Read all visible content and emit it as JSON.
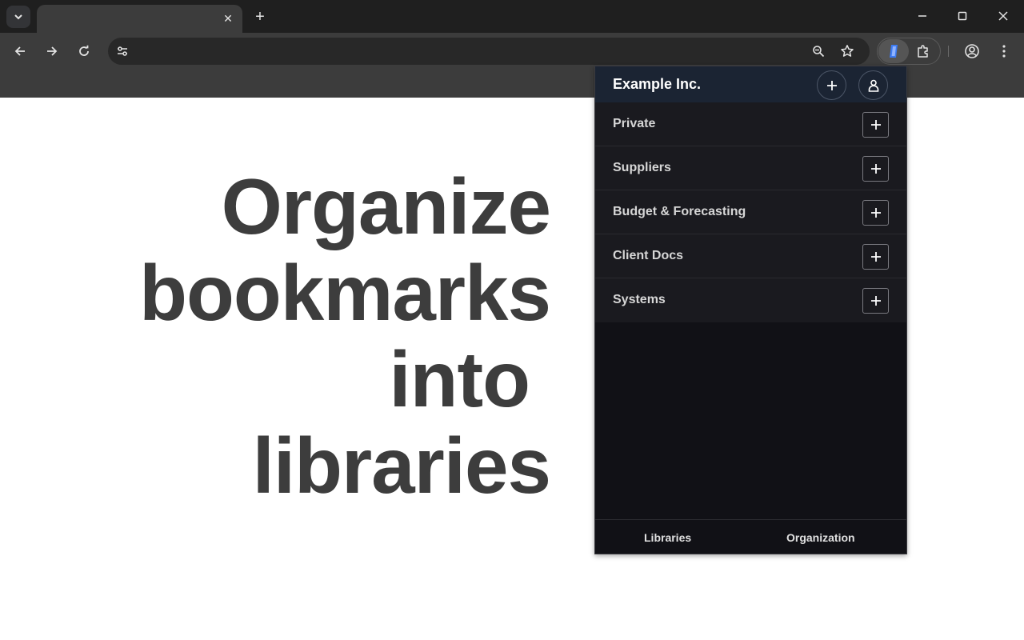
{
  "browser": {
    "tab_close": "✕",
    "new_tab": "+",
    "address": ""
  },
  "headline": {
    "lines": [
      "Organize",
      "bookmarks",
      "into",
      "libraries"
    ]
  },
  "popup": {
    "org_name": "Example Inc.",
    "libraries": [
      {
        "label": "Private"
      },
      {
        "label": "Suppliers"
      },
      {
        "label": "Budget & Forecasting"
      },
      {
        "label": "Client Docs"
      },
      {
        "label": "Systems"
      }
    ],
    "footer_tabs": [
      {
        "label": "Libraries",
        "active": true
      },
      {
        "label": "Organization",
        "active": false
      }
    ]
  },
  "icons": {
    "tab_search": "chevron-down-icon",
    "back": "arrow-left-icon",
    "forward": "arrow-right-icon",
    "reload": "reload-icon",
    "site_info": "tune-icon",
    "zoom": "zoom-icon",
    "bookmark": "star-icon",
    "extensions": "puzzle-icon",
    "profile": "profile-icon",
    "menu": "kebab-menu-icon"
  },
  "colors": {
    "popup_bg": "#111116",
    "popup_header": "#1b2433",
    "headline": "#3d3d3d"
  }
}
